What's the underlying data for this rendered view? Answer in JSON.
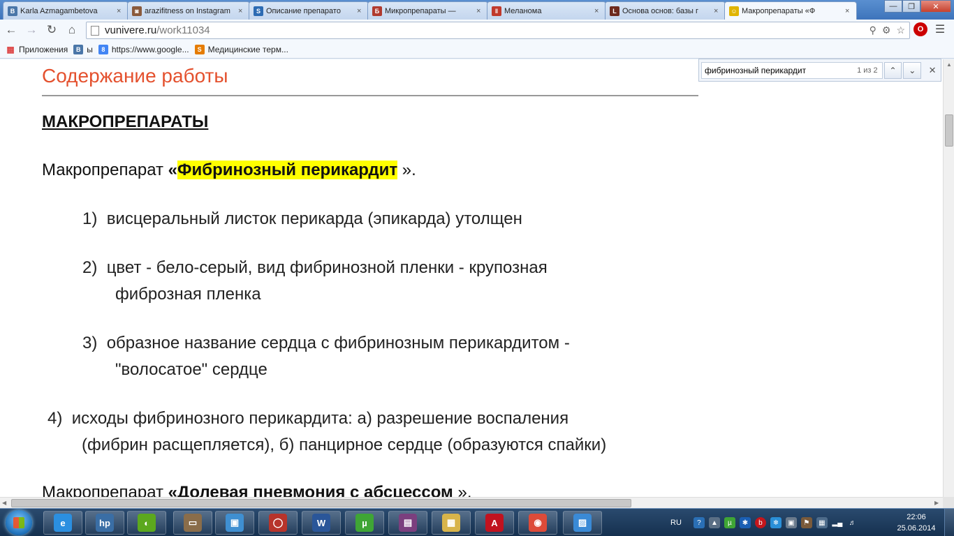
{
  "browser": {
    "tabs": [
      {
        "label": "Karla Azmagambetova",
        "icon": "vk-icon",
        "color": "#4a76a8",
        "glyph": "В"
      },
      {
        "label": "arazifitness on Instagram",
        "icon": "instagram-icon",
        "color": "#8a5a3c",
        "glyph": "◙"
      },
      {
        "label": "Описание препарато",
        "icon": "s-icon",
        "color": "#2c6bb3",
        "glyph": "S"
      },
      {
        "label": "Микропрепараты —",
        "icon": "page-icon",
        "color": "#b03a2e",
        "glyph": "Б"
      },
      {
        "label": "Меланома",
        "icon": "bars-icon",
        "color": "#c0392b",
        "glyph": "‖"
      },
      {
        "label": "Основа основ: базы г",
        "icon": "site-icon",
        "color": "#6d2a1e",
        "glyph": "L"
      },
      {
        "label": "Макропрепараты «Ф",
        "icon": "smiley-icon",
        "color": "#e0b400",
        "glyph": "☺",
        "active": true
      }
    ],
    "url_host": "vunivere.ru",
    "url_path": "/work11034",
    "bookmarks": {
      "apps": "Приложения",
      "items": [
        {
          "label": "ы",
          "glyph": "В",
          "color": "#4a76a8"
        },
        {
          "label": "https://www.google...",
          "glyph": "8",
          "color": "#4285f4"
        },
        {
          "label": "Медицинские терм...",
          "glyph": "S",
          "color": "#e57c00"
        }
      ]
    },
    "extension_label": "O",
    "find": {
      "query": "фибринозный перикардит",
      "count": "1 из 2"
    }
  },
  "page": {
    "section_title": "Содержание работы",
    "heading": "МАКРОПРЕПАРАТЫ",
    "prep1": {
      "prefix": "Макропрепарат ",
      "open_quote": "«",
      "highlight": "Фибринозный перикардит",
      "close": " ».",
      "items": [
        {
          "num": "1)",
          "text": "висцеральный листок перикарда (эпикарда) утолщен",
          "cont": ""
        },
        {
          "num": "2)",
          "text": "цвет - бело-серый, вид фибринозной  пленки - крупозная",
          "cont": "фиброзная пленка"
        },
        {
          "num": "3)",
          "text": "образное название сердца с фибринозным перикардитом -",
          "cont": "\"волосатое\" сердце"
        },
        {
          "num": "4)",
          "text": "исходы фибринозного перикардита: а) разрешение воспаления",
          "cont": "(фибрин расщепляется), б) панцирное сердце (образуются спайки)"
        }
      ]
    },
    "prep2": {
      "prefix": "Макропрепарат ",
      "bold": "«Долевая пневмония с абсцессом",
      "close": " »."
    }
  },
  "taskbar": {
    "items": [
      {
        "name": "ie-icon",
        "glyph": "e",
        "color": "#2b8fe0"
      },
      {
        "name": "hp-icon",
        "glyph": "hp",
        "color": "#3a6ea5"
      },
      {
        "name": "media-icon",
        "glyph": "◐",
        "color": "#5ca81e"
      },
      {
        "name": "scanner-icon",
        "glyph": "▭",
        "color": "#8a6d4a"
      },
      {
        "name": "photo-viewer-icon",
        "glyph": "▣",
        "color": "#3f8fd1"
      },
      {
        "name": "opera-icon",
        "glyph": "◯",
        "color": "#b7342b"
      },
      {
        "name": "word-icon",
        "glyph": "W",
        "color": "#2a5699"
      },
      {
        "name": "utorrent-icon",
        "glyph": "µ",
        "color": "#3fa535"
      },
      {
        "name": "winrar-icon",
        "glyph": "▤",
        "color": "#7b3f7e"
      },
      {
        "name": "explorer-icon",
        "glyph": "▦",
        "color": "#d8b44a"
      },
      {
        "name": "acrobat-icon",
        "glyph": "A",
        "color": "#c1121f"
      },
      {
        "name": "chrome-icon",
        "glyph": "◉",
        "color": "#dd4b39"
      },
      {
        "name": "paint-icon",
        "glyph": "▨",
        "color": "#3a8ad6"
      }
    ],
    "lang": "RU",
    "time": "22:06",
    "date": "25.06.2014"
  }
}
